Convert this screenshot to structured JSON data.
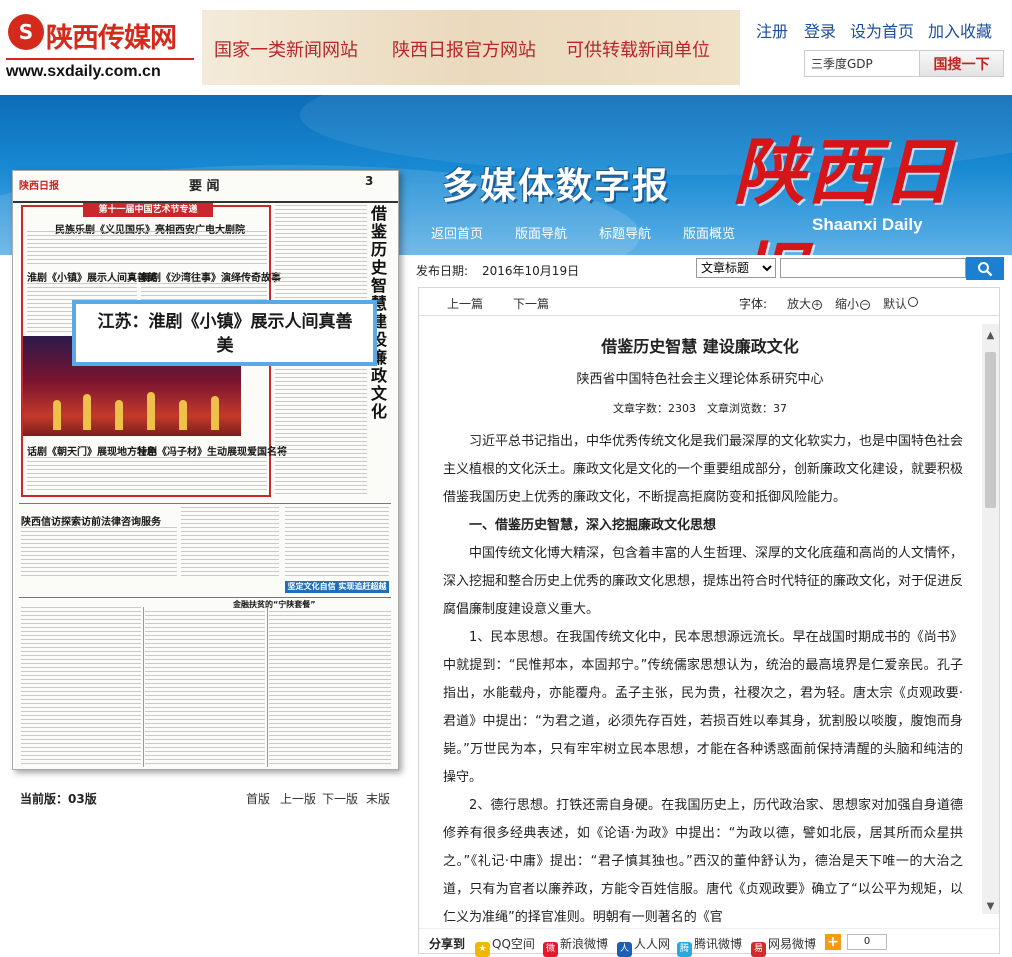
{
  "site": {
    "name": "陕西传媒网",
    "url": "www.sxdaily.com.cn",
    "slogans": [
      "国家一类新闻网站",
      "陕西日报官方网站",
      "可供转载新闻单位"
    ],
    "links": [
      "注册",
      "登录",
      "设为首页",
      "加入收藏"
    ],
    "search_value": "三季度GDP",
    "search_button": "国搜一下"
  },
  "banner": {
    "multimedia_title": "多媒体数字报",
    "brand": "陕西日报",
    "brand_en": "Shaanxi Daily",
    "nav": [
      "返回首页",
      "版面导航",
      "标题导航",
      "版面概览"
    ]
  },
  "paper": {
    "section": "要 闻",
    "page_no": "3",
    "banner_text": "第十一届中国艺术节专递",
    "vertical_title": "借鉴历史智慧 建设廉政文化",
    "headlines": [
      "民族乐剧《义见国乐》亮相西安广电大剧院",
      "淮剧《小镇》展示人间真善美",
      "舞剧《沙湾往事》演绎传奇故事",
      "话剧《朝天门》展现地方特色",
      "壮剧《冯子材》生动展现爱国名将",
      "陕西信访探索访前法律咨询服务",
      "金融扶贫的“宁陕套餐”"
    ],
    "blue_bar": "坚定文化自信 实现追赶超越",
    "hotspot_title": "江苏：淮剧《小镇》展示人间真善美"
  },
  "pager": {
    "current": "当前版：03版",
    "links": [
      "首版",
      "上一版",
      "下一版",
      "末版"
    ]
  },
  "search_bar": {
    "label": "发布日期:",
    "date": "2016年10月19日",
    "select": "文章标题"
  },
  "toolbar": {
    "prev": "上一篇",
    "next": "下一篇",
    "font_label": "字体:",
    "zoom_in": "放大",
    "zoom_out": "缩小",
    "default": "默认"
  },
  "article": {
    "title": "借鉴历史智慧 建设廉政文化",
    "org": "陕西省中国特色社会主义理论体系研究中心",
    "stats": "文章字数：2303　文章浏览数：37",
    "paragraphs": [
      "习近平总书记指出，中华优秀传统文化是我们最深厚的文化软实力，也是中国特色社会主义植根的文化沃土。廉政文化是文化的一个重要组成部分，创新廉政文化建设，就要积极借鉴我国历史上优秀的廉政文化，不断提高拒腐防变和抵御风险能力。",
      "一、借鉴历史智慧，深入挖掘廉政文化思想",
      "中国传统文化博大精深，包含着丰富的人生哲理、深厚的文化底蕴和高尚的人文情怀，深入挖掘和整合历史上优秀的廉政文化思想，提炼出符合时代特征的廉政文化，对于促进反腐倡廉制度建设意义重大。",
      "1、民本思想。在我国传统文化中，民本思想源远流长。早在战国时期成书的《尚书》中就提到：“民惟邦本，本固邦宁。”传统儒家思想认为，统治的最高境界是仁爱亲民。孔子指出，水能载舟，亦能覆舟。孟子主张，民为贵，社稷次之，君为轻。唐太宗《贞观政要·君道》中提出：“为君之道，必须先存百姓，若损百姓以奉其身，犹割股以啖腹，腹饱而身毙。”万世民为本，只有牢牢树立民本思想，才能在各种诱惑面前保持清醒的头脑和纯洁的操守。",
      "2、德行思想。打铁还需自身硬。在我国历史上，历代政治家、思想家对加强自身道德修养有很多经典表述，如《论语·为政》中提出：“为政以德，譬如北辰，居其所而众星拱之。”《礼记·中庸》提出：“君子慎其独也。”西汉的董仲舒认为，德治是天下唯一的大治之道，只有为官者以廉养政，方能令百姓信服。唐代《贞观政要》确立了“以公平为规矩，以仁义为准绳”的择官准则。明朝有一则著名的《官"
    ]
  },
  "share": {
    "label": "分享到",
    "items": [
      "QQ空间",
      "新浪微博",
      "人人网",
      "腾讯微博",
      "网易微博"
    ],
    "count": "0"
  }
}
